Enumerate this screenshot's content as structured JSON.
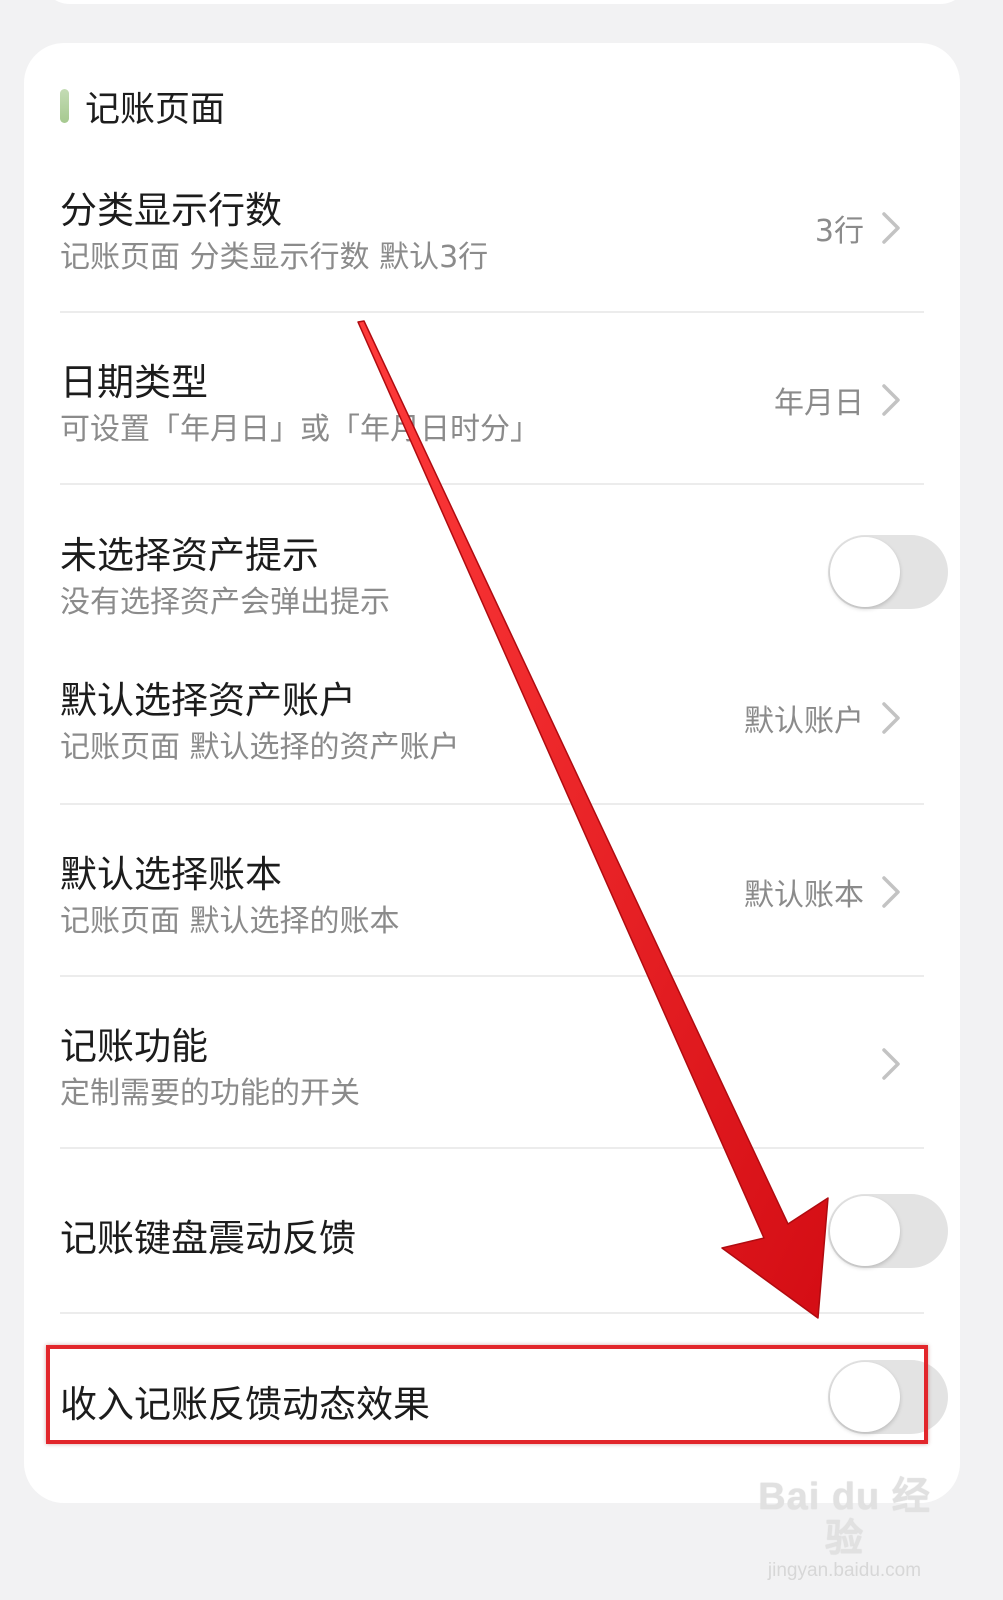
{
  "section": {
    "title": "记账页面"
  },
  "rows": [
    {
      "title": "分类显示行数",
      "subtitle": "记账页面 分类显示行数 默认3行",
      "value": "3行",
      "control": "chevron"
    },
    {
      "title": "日期类型",
      "subtitle": "可设置「年月日」或「年月日时分」",
      "value": "年月日",
      "control": "chevron"
    },
    {
      "title": "未选择资产提示",
      "subtitle": "没有选择资产会弹出提示",
      "control": "toggle",
      "toggle_on": false
    },
    {
      "title": "默认选择资产账户",
      "subtitle": "记账页面 默认选择的资产账户",
      "value": "默认账户",
      "control": "chevron"
    },
    {
      "title": "默认选择账本",
      "subtitle": "记账页面 默认选择的账本",
      "value": "默认账本",
      "control": "chevron"
    },
    {
      "title": "记账功能",
      "subtitle": "定制需要的功能的开关",
      "control": "chevron"
    },
    {
      "title": "记账键盘震动反馈",
      "control": "toggle",
      "toggle_on": false
    },
    {
      "title": "收入记账反馈动态效果",
      "control": "toggle",
      "toggle_on": false,
      "highlighted": true
    }
  ],
  "annotation": {
    "arrow_color": "#e8141b",
    "box_color": "#e2262b"
  },
  "watermark": {
    "main": "Bai du 经验",
    "url": "jingyan.baidu.com"
  },
  "colors": {
    "background": "#f2f2f3",
    "card": "#ffffff",
    "title_text": "#1c1c1c",
    "secondary_text": "#8b8b8b",
    "accent_bar": "#a6c98f",
    "toggle_off_track": "#e3e3e3"
  }
}
